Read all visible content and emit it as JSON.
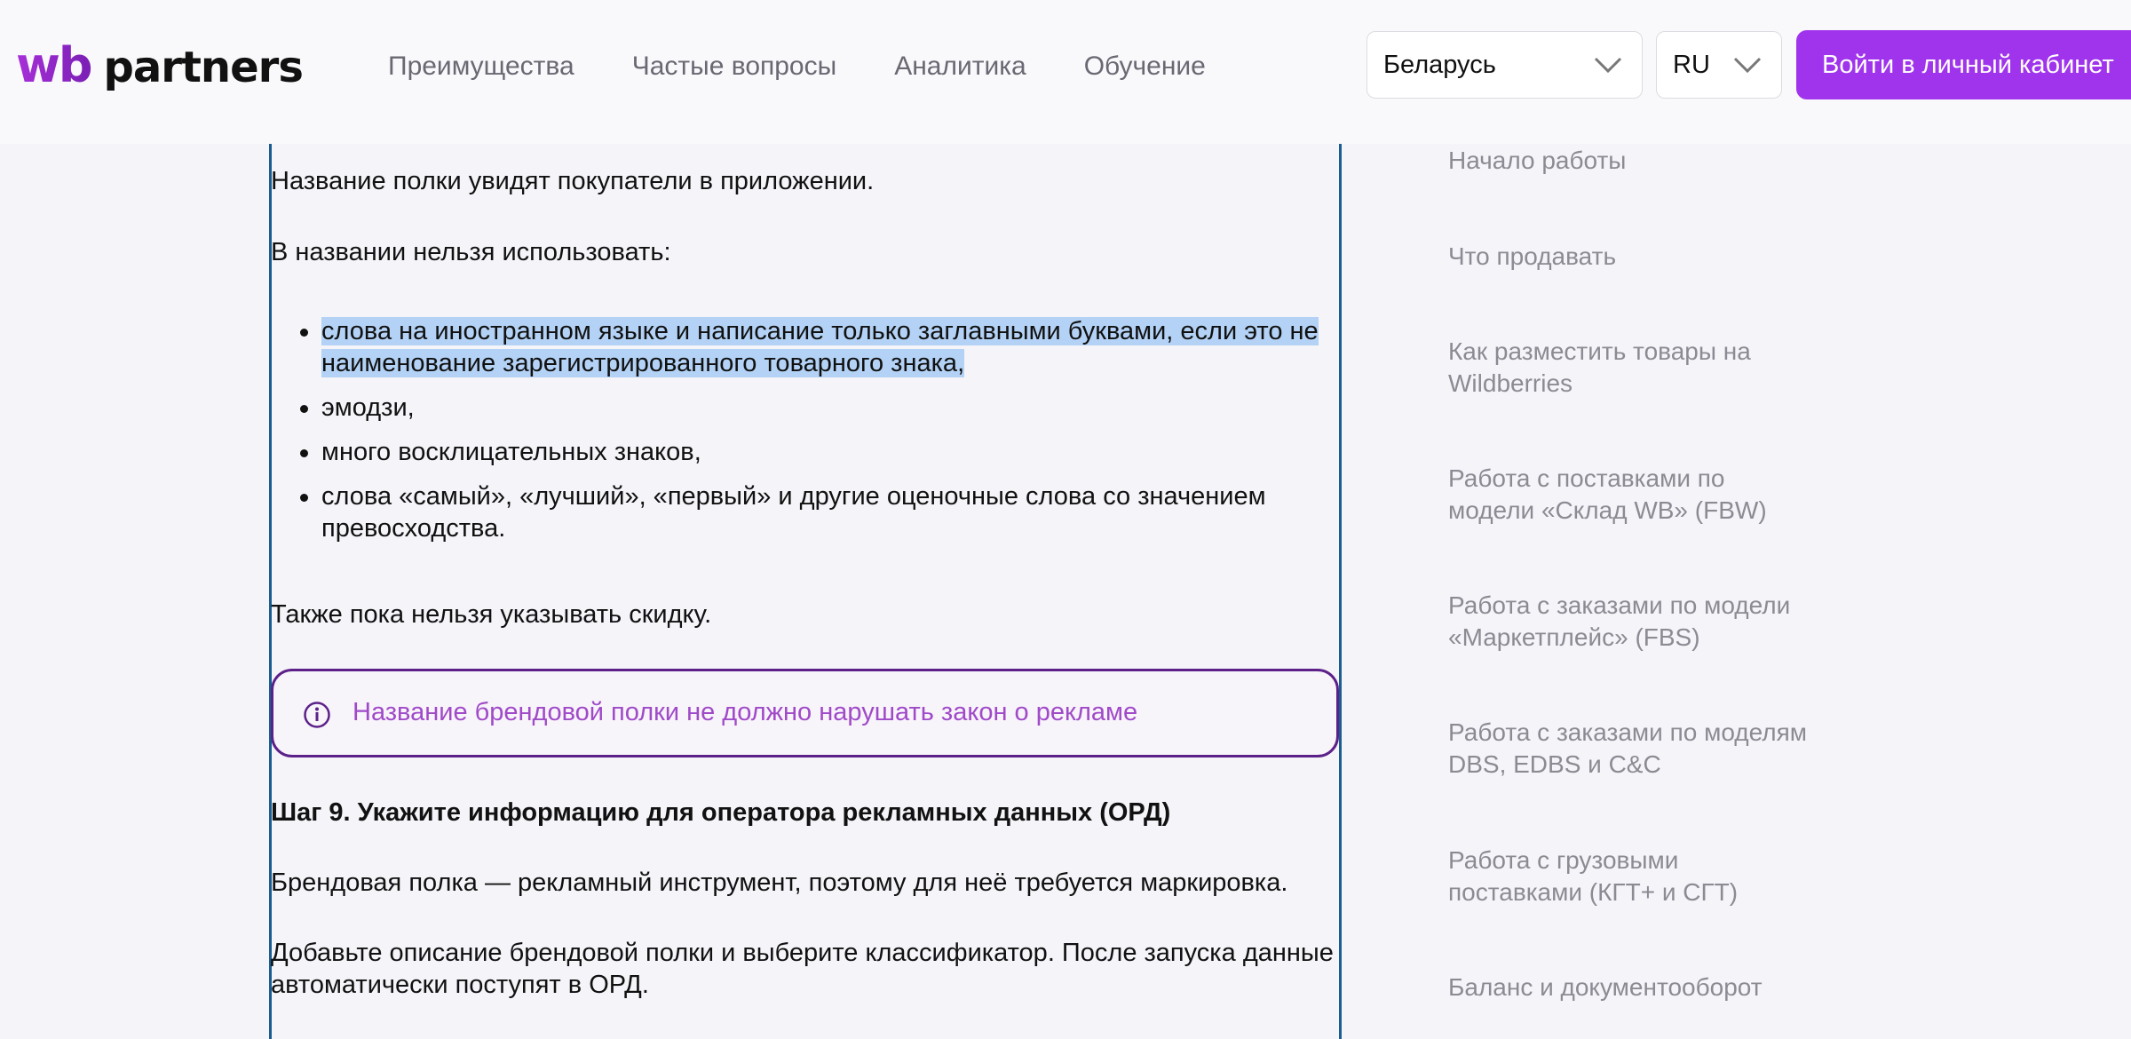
{
  "header": {
    "logo_wb": "wb",
    "logo_partners": "partners",
    "nav": [
      "Преимущества",
      "Частые вопросы",
      "Аналитика",
      "Обучение"
    ],
    "country_select": "Беларусь",
    "language_select": "RU",
    "login_button": "Войти в личный кабинет"
  },
  "article": {
    "p1": "Название полки увидят покупатели в приложении.",
    "p2": "В названии нельзя использовать:",
    "bullets": [
      {
        "line1": "слова на иностранном языке и написание только заглавными буквами, если это не",
        "line2": "наименование зарегистрированного товарного знака,"
      },
      {
        "line1": "эмодзи,"
      },
      {
        "line1": "много восклицательных знаков,"
      },
      {
        "line1": "слова «самый», «лучший», «первый» и другие оценочные слова со значением",
        "line2": "превосходства."
      }
    ],
    "p3": "Также пока нельзя указывать скидку.",
    "callout": "Название брендовой полки не должно нарушать закон о рекламе",
    "step_heading": "Шаг 9. Укажите информацию для оператора рекламных данных (ОРД)",
    "p4": "Брендовая полка — рекламный инструмент, поэтому для неё требуется маркировка.",
    "p5_line1": "Добавьте описание брендовой полки и выберите классификатор. После запуска данные",
    "p5_line2": "автоматически поступят в ОРД."
  },
  "sidebar": {
    "items": [
      {
        "line1": "Начало работы"
      },
      {
        "line1": "Что продавать"
      },
      {
        "line1": "Как разместить товары на",
        "line2": "Wildberries"
      },
      {
        "line1": "Работа с поставками по",
        "line2": "модели «Склад WB» (FBW)"
      },
      {
        "line1": "Работа с заказами по модели",
        "line2": "«Маркетплейс» (FBS)"
      },
      {
        "line1": "Работа с заказами по моделям",
        "line2": "DBS, EDBS и C&C"
      },
      {
        "line1": "Работа с грузовыми",
        "line2": "поставками (КГТ+ и СГТ)"
      },
      {
        "line1": "Баланс и документооборот"
      }
    ]
  },
  "colors": {
    "accent": "#a034ec",
    "callout_border": "#5c2189",
    "callout_text": "#a04ac8",
    "selection_highlight": "#b3d2f5",
    "frame_border": "#1b5d91"
  }
}
